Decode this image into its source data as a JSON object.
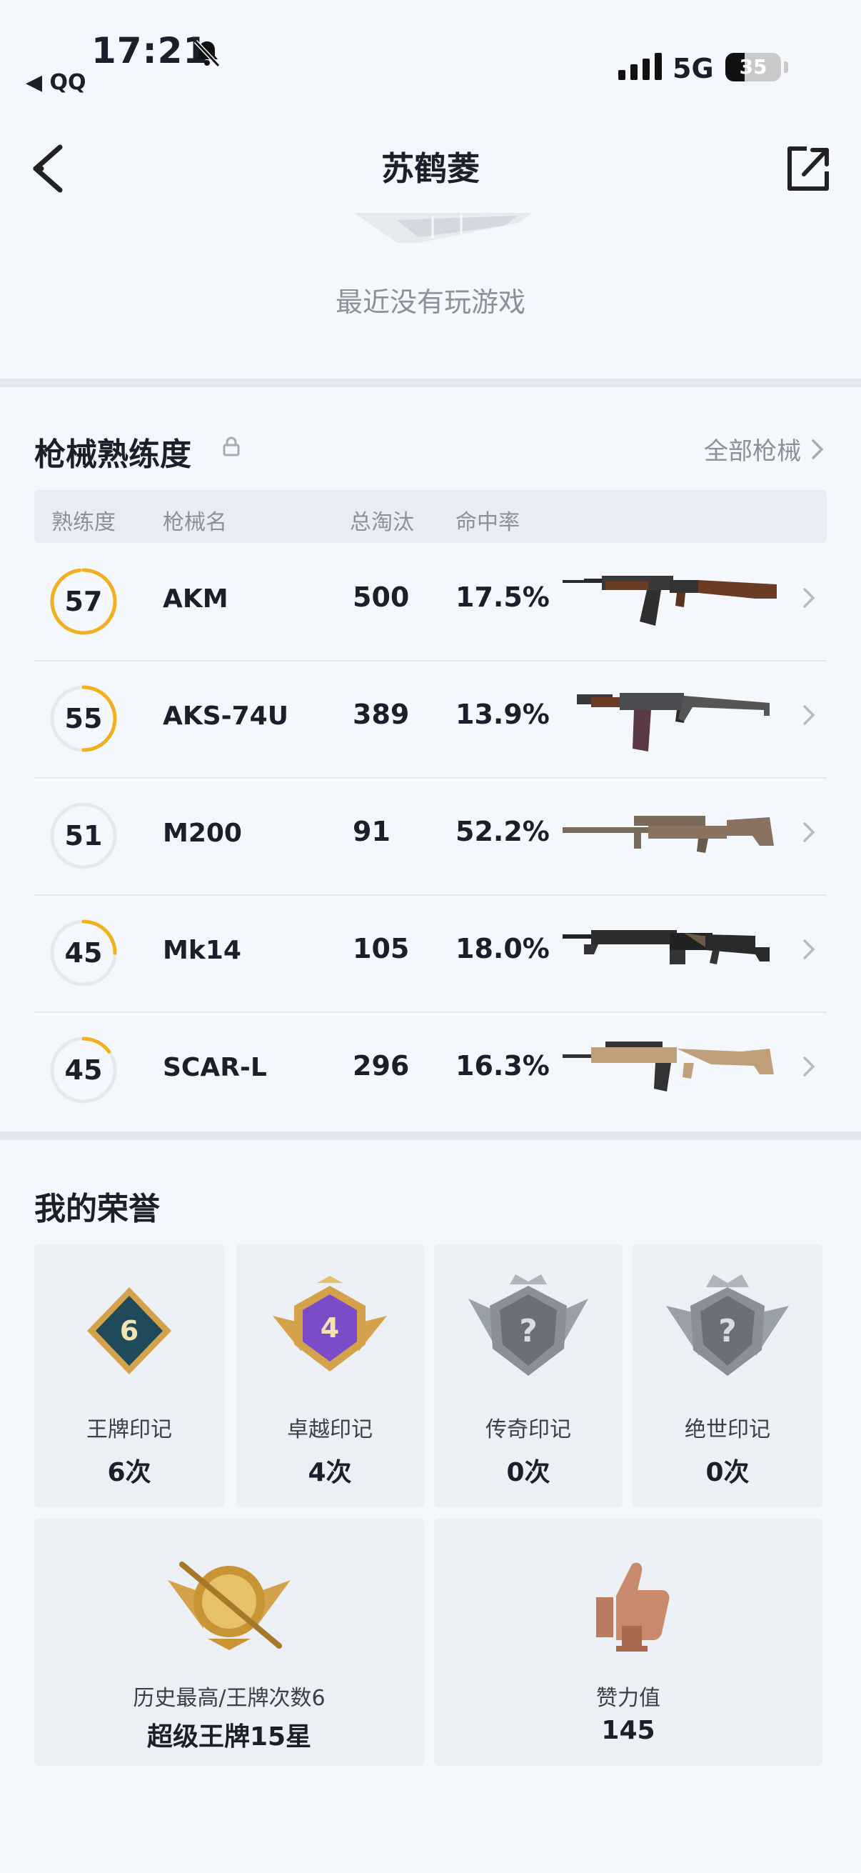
{
  "status": {
    "time": "17:21",
    "back_app": "◀ QQ",
    "network": "5G",
    "battery": "35",
    "battery_pct": 0.35
  },
  "nav": {
    "title": "苏鹤菱"
  },
  "recent": {
    "text": "最近没有玩游戏"
  },
  "weapons": {
    "title": "枪械熟练度",
    "all_link": "全部枪械",
    "headers": [
      "熟练度",
      "枪械名",
      "总淘汰",
      "命中率"
    ],
    "rows": [
      {
        "level": "57",
        "name": "AKM",
        "kills": "500",
        "accuracy": "17.5%",
        "progress": 0.98,
        "icon": "akm-rifle-image"
      },
      {
        "level": "55",
        "name": "AKS-74U",
        "kills": "389",
        "accuracy": "13.9%",
        "progress": 0.5,
        "icon": "aks74u-rifle-image"
      },
      {
        "level": "51",
        "name": "M200",
        "kills": "91",
        "accuracy": "52.2%",
        "progress": 0.0,
        "icon": "m200-sniper-image"
      },
      {
        "level": "45",
        "name": "Mk14",
        "kills": "105",
        "accuracy": "18.0%",
        "progress": 0.25,
        "icon": "mk14-rifle-image"
      },
      {
        "level": "45",
        "name": "SCAR-L",
        "kills": "296",
        "accuracy": "16.3%",
        "progress": 0.15,
        "icon": "scarl-rifle-image"
      }
    ]
  },
  "honors": {
    "title": "我的荣誉",
    "badges": [
      {
        "label": "王牌印记",
        "value": "6次",
        "badge_text": "6"
      },
      {
        "label": "卓越印记",
        "value": "4次",
        "badge_text": "4"
      },
      {
        "label": "传奇印记",
        "value": "0次",
        "badge_text": "?"
      },
      {
        "label": "绝世印记",
        "value": "0次",
        "badge_text": "?"
      }
    ],
    "rank": {
      "label": "历史最高/王牌次数6",
      "value": "超级王牌15星"
    },
    "likes": {
      "label": "赞力值",
      "value": "145"
    }
  },
  "colors": {
    "accent": "#f2b01e",
    "ring_track": "#e6e8ec",
    "gold": "#d4a24a",
    "purple": "#7b4cc8",
    "silver": "#8a8f98",
    "bronze": "#b97a5e"
  }
}
